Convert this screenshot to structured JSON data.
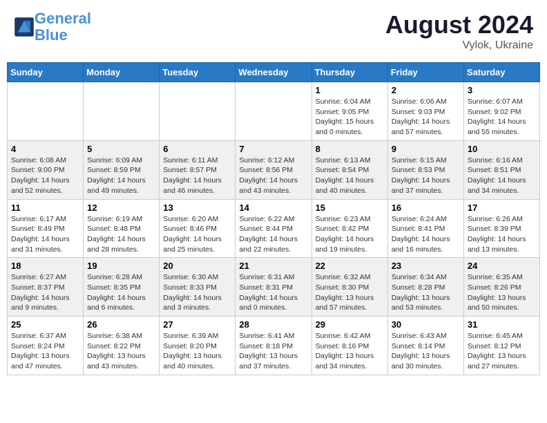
{
  "header": {
    "logo_line1": "General",
    "logo_line2": "Blue",
    "month": "August 2024",
    "location": "Vylok, Ukraine"
  },
  "days_of_week": [
    "Sunday",
    "Monday",
    "Tuesday",
    "Wednesday",
    "Thursday",
    "Friday",
    "Saturday"
  ],
  "weeks": [
    [
      {
        "day": "",
        "detail": ""
      },
      {
        "day": "",
        "detail": ""
      },
      {
        "day": "",
        "detail": ""
      },
      {
        "day": "",
        "detail": ""
      },
      {
        "day": "1",
        "detail": "Sunrise: 6:04 AM\nSunset: 9:05 PM\nDaylight: 15 hours\nand 0 minutes."
      },
      {
        "day": "2",
        "detail": "Sunrise: 6:06 AM\nSunset: 9:03 PM\nDaylight: 14 hours\nand 57 minutes."
      },
      {
        "day": "3",
        "detail": "Sunrise: 6:07 AM\nSunset: 9:02 PM\nDaylight: 14 hours\nand 55 minutes."
      }
    ],
    [
      {
        "day": "4",
        "detail": "Sunrise: 6:08 AM\nSunset: 9:00 PM\nDaylight: 14 hours\nand 52 minutes."
      },
      {
        "day": "5",
        "detail": "Sunrise: 6:09 AM\nSunset: 8:59 PM\nDaylight: 14 hours\nand 49 minutes."
      },
      {
        "day": "6",
        "detail": "Sunrise: 6:11 AM\nSunset: 8:57 PM\nDaylight: 14 hours\nand 46 minutes."
      },
      {
        "day": "7",
        "detail": "Sunrise: 6:12 AM\nSunset: 8:56 PM\nDaylight: 14 hours\nand 43 minutes."
      },
      {
        "day": "8",
        "detail": "Sunrise: 6:13 AM\nSunset: 8:54 PM\nDaylight: 14 hours\nand 40 minutes."
      },
      {
        "day": "9",
        "detail": "Sunrise: 6:15 AM\nSunset: 8:53 PM\nDaylight: 14 hours\nand 37 minutes."
      },
      {
        "day": "10",
        "detail": "Sunrise: 6:16 AM\nSunset: 8:51 PM\nDaylight: 14 hours\nand 34 minutes."
      }
    ],
    [
      {
        "day": "11",
        "detail": "Sunrise: 6:17 AM\nSunset: 8:49 PM\nDaylight: 14 hours\nand 31 minutes."
      },
      {
        "day": "12",
        "detail": "Sunrise: 6:19 AM\nSunset: 8:48 PM\nDaylight: 14 hours\nand 28 minutes."
      },
      {
        "day": "13",
        "detail": "Sunrise: 6:20 AM\nSunset: 8:46 PM\nDaylight: 14 hours\nand 25 minutes."
      },
      {
        "day": "14",
        "detail": "Sunrise: 6:22 AM\nSunset: 8:44 PM\nDaylight: 14 hours\nand 22 minutes."
      },
      {
        "day": "15",
        "detail": "Sunrise: 6:23 AM\nSunset: 8:42 PM\nDaylight: 14 hours\nand 19 minutes."
      },
      {
        "day": "16",
        "detail": "Sunrise: 6:24 AM\nSunset: 8:41 PM\nDaylight: 14 hours\nand 16 minutes."
      },
      {
        "day": "17",
        "detail": "Sunrise: 6:26 AM\nSunset: 8:39 PM\nDaylight: 14 hours\nand 13 minutes."
      }
    ],
    [
      {
        "day": "18",
        "detail": "Sunrise: 6:27 AM\nSunset: 8:37 PM\nDaylight: 14 hours\nand 9 minutes."
      },
      {
        "day": "19",
        "detail": "Sunrise: 6:28 AM\nSunset: 8:35 PM\nDaylight: 14 hours\nand 6 minutes."
      },
      {
        "day": "20",
        "detail": "Sunrise: 6:30 AM\nSunset: 8:33 PM\nDaylight: 14 hours\nand 3 minutes."
      },
      {
        "day": "21",
        "detail": "Sunrise: 6:31 AM\nSunset: 8:31 PM\nDaylight: 14 hours\nand 0 minutes."
      },
      {
        "day": "22",
        "detail": "Sunrise: 6:32 AM\nSunset: 8:30 PM\nDaylight: 13 hours\nand 57 minutes."
      },
      {
        "day": "23",
        "detail": "Sunrise: 6:34 AM\nSunset: 8:28 PM\nDaylight: 13 hours\nand 53 minutes."
      },
      {
        "day": "24",
        "detail": "Sunrise: 6:35 AM\nSunset: 8:26 PM\nDaylight: 13 hours\nand 50 minutes."
      }
    ],
    [
      {
        "day": "25",
        "detail": "Sunrise: 6:37 AM\nSunset: 8:24 PM\nDaylight: 13 hours\nand 47 minutes."
      },
      {
        "day": "26",
        "detail": "Sunrise: 6:38 AM\nSunset: 8:22 PM\nDaylight: 13 hours\nand 43 minutes."
      },
      {
        "day": "27",
        "detail": "Sunrise: 6:39 AM\nSunset: 8:20 PM\nDaylight: 13 hours\nand 40 minutes."
      },
      {
        "day": "28",
        "detail": "Sunrise: 6:41 AM\nSunset: 8:18 PM\nDaylight: 13 hours\nand 37 minutes."
      },
      {
        "day": "29",
        "detail": "Sunrise: 6:42 AM\nSunset: 8:16 PM\nDaylight: 13 hours\nand 34 minutes."
      },
      {
        "day": "30",
        "detail": "Sunrise: 6:43 AM\nSunset: 8:14 PM\nDaylight: 13 hours\nand 30 minutes."
      },
      {
        "day": "31",
        "detail": "Sunrise: 6:45 AM\nSunset: 8:12 PM\nDaylight: 13 hours\nand 27 minutes."
      }
    ]
  ]
}
